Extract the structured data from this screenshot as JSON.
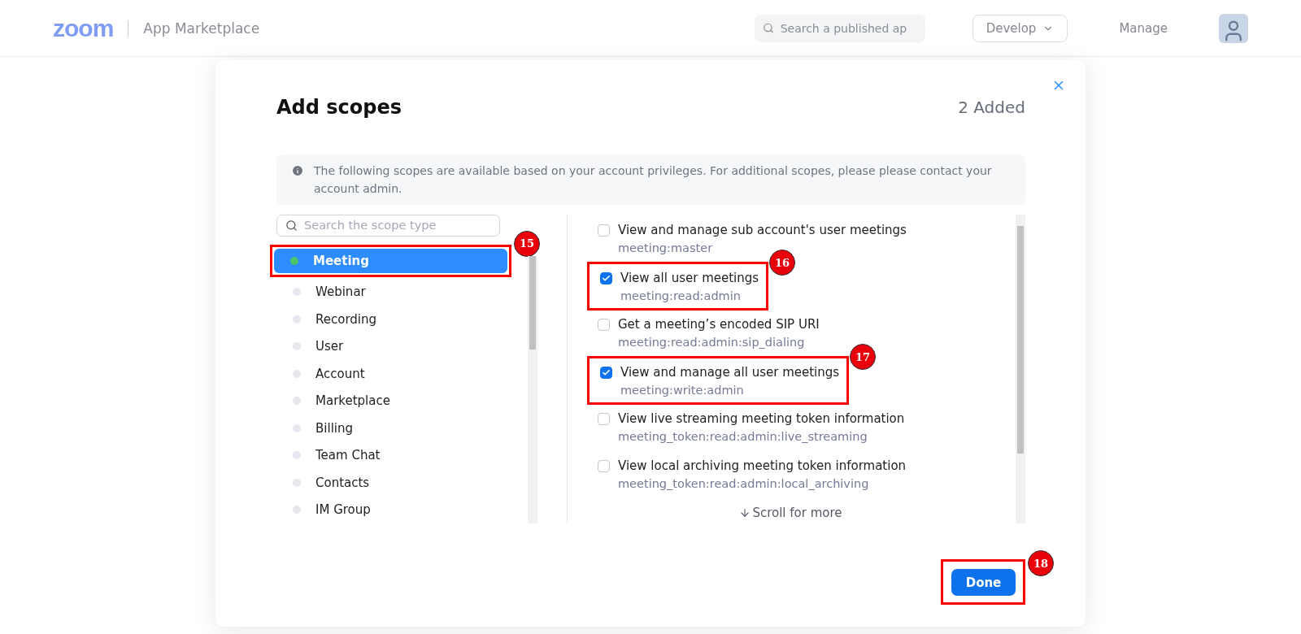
{
  "header": {
    "logo": "zoom",
    "title": "App Marketplace",
    "search": {
      "placeholder": "Search a published ap"
    },
    "develop": "Develop",
    "manage": "Manage"
  },
  "dialog": {
    "title": "Add scopes",
    "added": "2 Added",
    "notice": "The following scopes are available based on your account privileges. For additional scopes, please please contact your account admin.",
    "search": {
      "placeholder": "Search the scope type"
    },
    "categories": [
      {
        "label": "Meeting",
        "selected": true,
        "callout": "15"
      },
      {
        "label": "Webinar",
        "selected": false
      },
      {
        "label": "Recording",
        "selected": false
      },
      {
        "label": "User",
        "selected": false
      },
      {
        "label": "Account",
        "selected": false
      },
      {
        "label": "Marketplace",
        "selected": false
      },
      {
        "label": "Billing",
        "selected": false
      },
      {
        "label": "Team Chat",
        "selected": false
      },
      {
        "label": "Contacts",
        "selected": false
      },
      {
        "label": "IM Group",
        "selected": false
      }
    ],
    "scopes": [
      {
        "title": "View and manage sub account's user meetings",
        "scope": "meeting:master",
        "checked": false
      },
      {
        "title": "View all user meetings",
        "scope": "meeting:read:admin",
        "checked": true,
        "callout": "16"
      },
      {
        "title": "Get a meeting’s encoded SIP URI",
        "scope": "meeting:read:admin:sip_dialing",
        "checked": false
      },
      {
        "title": "View and manage all user meetings",
        "scope": "meeting:write:admin",
        "checked": true,
        "callout": "17"
      },
      {
        "title": "View live streaming meeting token information",
        "scope": "meeting_token:read:admin:live_streaming",
        "checked": false
      },
      {
        "title": "View local archiving meeting token information",
        "scope": "meeting_token:read:admin:local_archiving",
        "checked": false
      }
    ],
    "scroll_hint": "Scroll for more",
    "done": {
      "label": "Done",
      "callout": "18"
    }
  }
}
